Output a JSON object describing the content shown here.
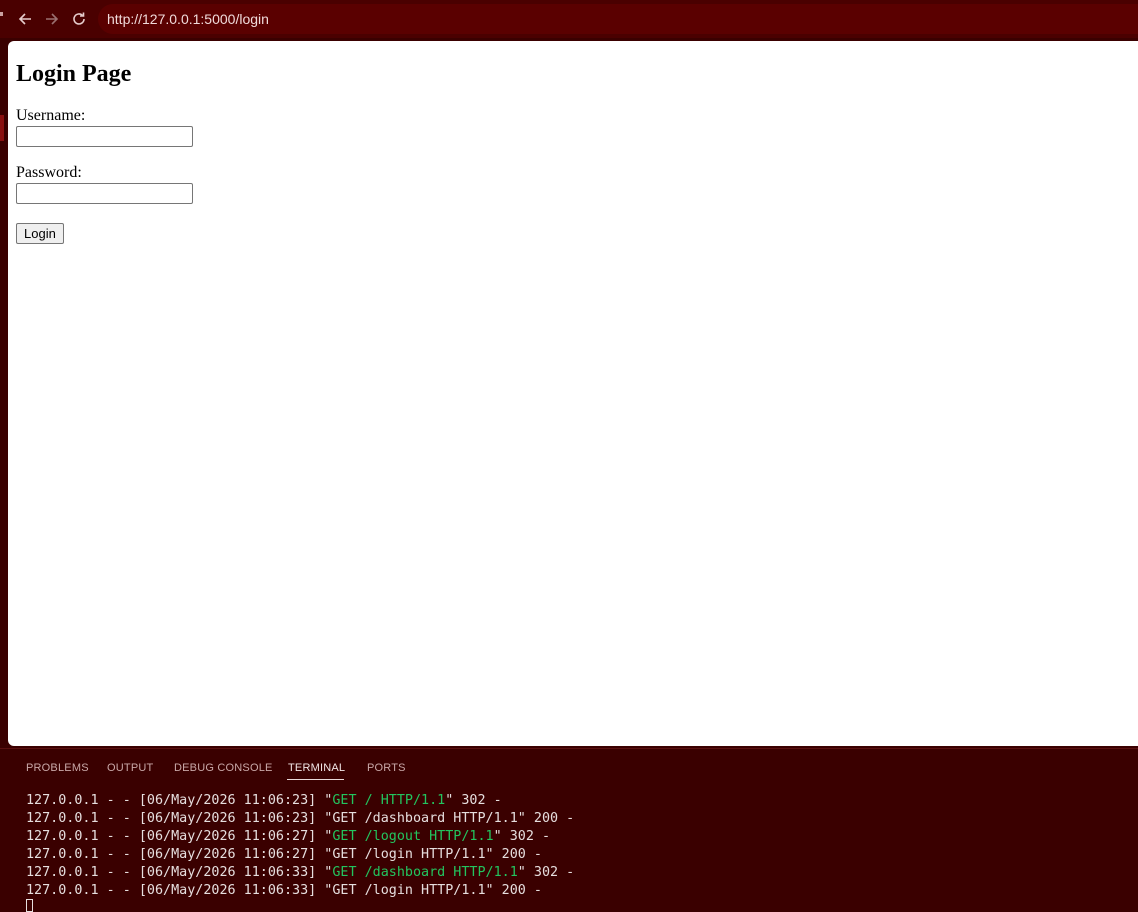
{
  "browser": {
    "url": "http://127.0.0.1:5000/login",
    "icons": [
      "back-arrow-icon",
      "forward-arrow-icon",
      "reload-icon"
    ]
  },
  "page": {
    "title": "Login Page",
    "username_label": "Username:",
    "username_value": "",
    "password_label": "Password:",
    "password_value": "",
    "login_button": "Login"
  },
  "panel": {
    "tabs": [
      "PROBLEMS",
      "OUTPUT",
      "DEBUG CONSOLE",
      "TERMINAL",
      "PORTS"
    ],
    "active_tab": "TERMINAL",
    "log": [
      {
        "pre": "127.0.0.1 - - [06/May/2026 11:06:23] \"",
        "req": "GET / HTTP/1.1",
        "req_highlight": true,
        "post": "\" 302 -"
      },
      {
        "pre": "127.0.0.1 - - [06/May/2026 11:06:23] \"",
        "req": "GET /dashboard HTTP/1.1",
        "req_highlight": false,
        "post": "\" 200 -"
      },
      {
        "pre": "127.0.0.1 - - [06/May/2026 11:06:27] \"",
        "req": "GET /logout HTTP/1.1",
        "req_highlight": true,
        "post": "\" 302 -"
      },
      {
        "pre": "127.0.0.1 - - [06/May/2026 11:06:27] \"",
        "req": "GET /login HTTP/1.1",
        "req_highlight": false,
        "post": "\" 200 -"
      },
      {
        "pre": "127.0.0.1 - - [06/May/2026 11:06:33] \"",
        "req": "GET /dashboard HTTP/1.1",
        "req_highlight": true,
        "post": "\" 302 -"
      },
      {
        "pre": "127.0.0.1 - - [06/May/2026 11:06:33] \"",
        "req": "GET /login HTTP/1.1",
        "req_highlight": false,
        "post": "\" 200 -"
      }
    ]
  },
  "colors": {
    "chrome_bg": "#4a0000",
    "panel_bg": "#3a0000",
    "redirect_green": "#23c45e"
  }
}
